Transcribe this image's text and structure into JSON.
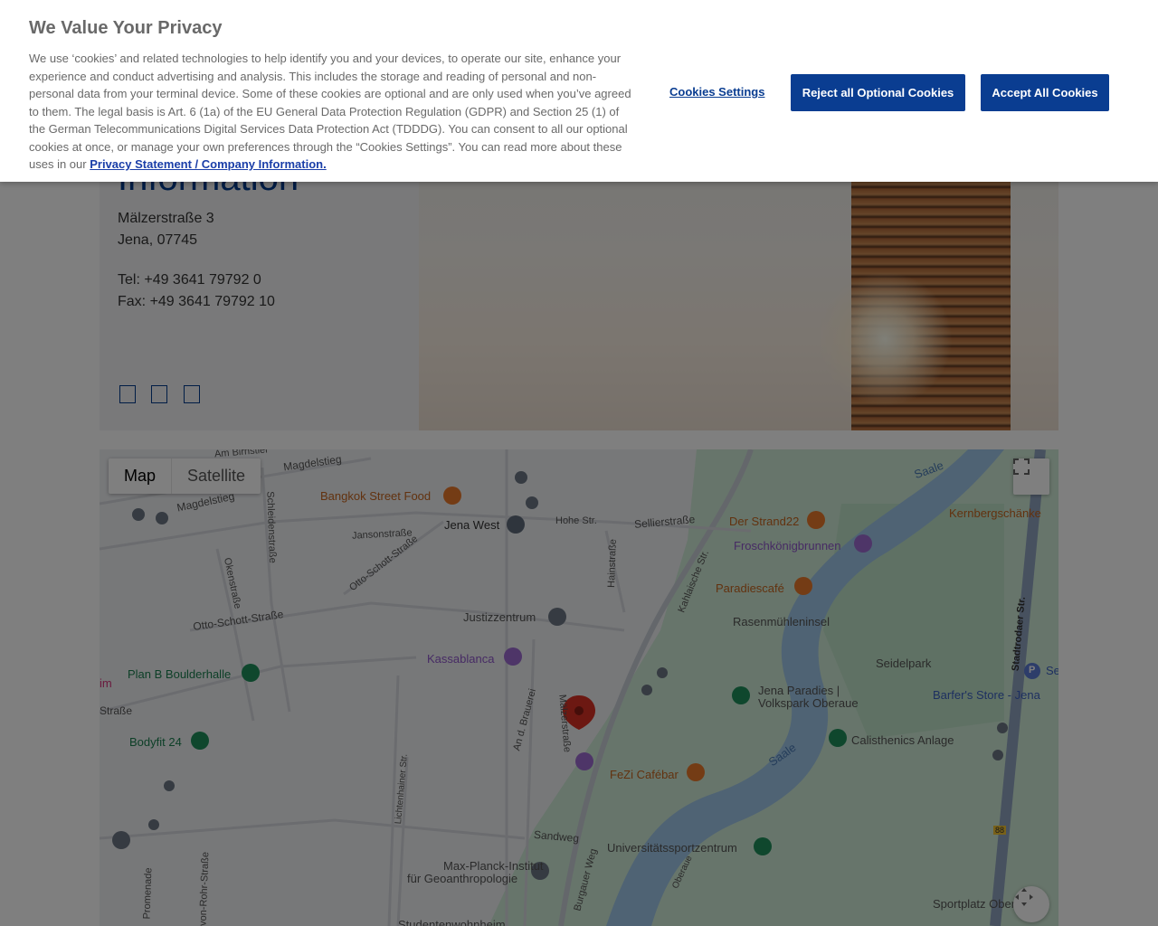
{
  "contact": {
    "heading": "Information",
    "street": "Mälzerstraße 3",
    "city": "Jena, 07745",
    "tel": "Tel: +49 3641 79792 0",
    "fax": "Fax: +49 3641 79792 10",
    "social_icons": [
      "linkedin-icon",
      "xing-icon",
      "youtube-icon"
    ]
  },
  "map": {
    "map_type_label": "Map",
    "satellite_label": "Satellite",
    "labels": {
      "am_birnstiel": "Am Birnstiel",
      "magdelstieg1": "Magdelstieg",
      "magdelstieg2": "Magdelstieg",
      "bangkok": "Bangkok Street Food",
      "jena_west": "Jena West",
      "hohe_str": "Hohe Str.",
      "sellierstrasse": "Sellierstraße",
      "der_strand": "Der Strand22",
      "kernberg": "Kernbergschänke",
      "frosch": "Froschkönigbrunnen",
      "paradiescafe": "Paradiescafé",
      "rasen": "Rasenmühleninsel",
      "jansonstrasse": "Jansonstraße",
      "otto_schott_diag": "Otto-Schott-Straße",
      "otto_schott": "Otto-Schott-Straße",
      "schleidenstrasse": "Schleidenstraße",
      "okenstrasse": "Okenstraße",
      "hainstrasse": "Hainstraße",
      "kahlaische": "Kahlaische Str.",
      "justizzentrum": "Justizzentrum",
      "kassablanca": "Kassablanca",
      "plan_b": "Plan B Boulderhalle",
      "seidelpark": "Seidelpark",
      "stadtrodaer": "Stadtrodaer Str.",
      "jena_paradies1": "Jena Paradies |",
      "jena_paradies2": "Volkspark Oberaue",
      "barfers": "Barfer's Store - Jena",
      "bodyfit": "Bodyfit 24",
      "malzerstrasse": "Mälzerstraße",
      "an_d_brauerei": "An d. Brauerei",
      "calisthenics": "Calisthenics Anlage",
      "fezi": "FeZi Cafébar",
      "saale1": "Saale",
      "saale2": "Saale",
      "lichtenhainer": "Lichtenhainer Str.",
      "sandweg": "Sandweg",
      "uni_sport": "Universitätssportzentrum",
      "max_planck1": "Max-Planck-Institut",
      "max_planck2": "für Geoanthropologie",
      "burgauer": "Burgauer Weg",
      "oberaue": "Oberaue",
      "sportplatz": "Sportplatz Ober",
      "promenade": "Promenade",
      "rohr": "von-Rohr-Straße",
      "studenten": "Studentenwohnheim",
      "strasse_left": "Straße",
      "im": "im",
      "se": "Se",
      "route88": "88",
      "parking": "P"
    }
  },
  "cookie_banner": {
    "title": "We Value Your Privacy",
    "body": "We use ‘cookies’ and related technologies to help identify you and your devices, to operate our site, enhance your experience and conduct advertising and analysis. This includes the storage and reading of personal and non-personal data from your terminal device. Some of these cookies are optional and are only used when you’ve agreed to them. The legal basis is Art. 6 (1a) of the EU General Data Protection Regulation (GDPR) and Section 25 (1) of the German Telecommunications Digital Services Data Protection Act (TDDDG). You can consent to all our optional cookies at once, or manage your own preferences through the “Cookies Settings”. You can read more about these uses in our",
    "privacy_link": "Privacy Statement / Company Information.",
    "settings_label": "Cookies Settings",
    "reject_label": "Reject all Optional Cookies",
    "accept_label": "Accept All Cookies"
  },
  "colors": {
    "brand_blue": "#0a3d91",
    "overlay": "rgba(0,0,0,0.5)",
    "park_green": "#cfead6",
    "water": "#9fc7e8"
  }
}
